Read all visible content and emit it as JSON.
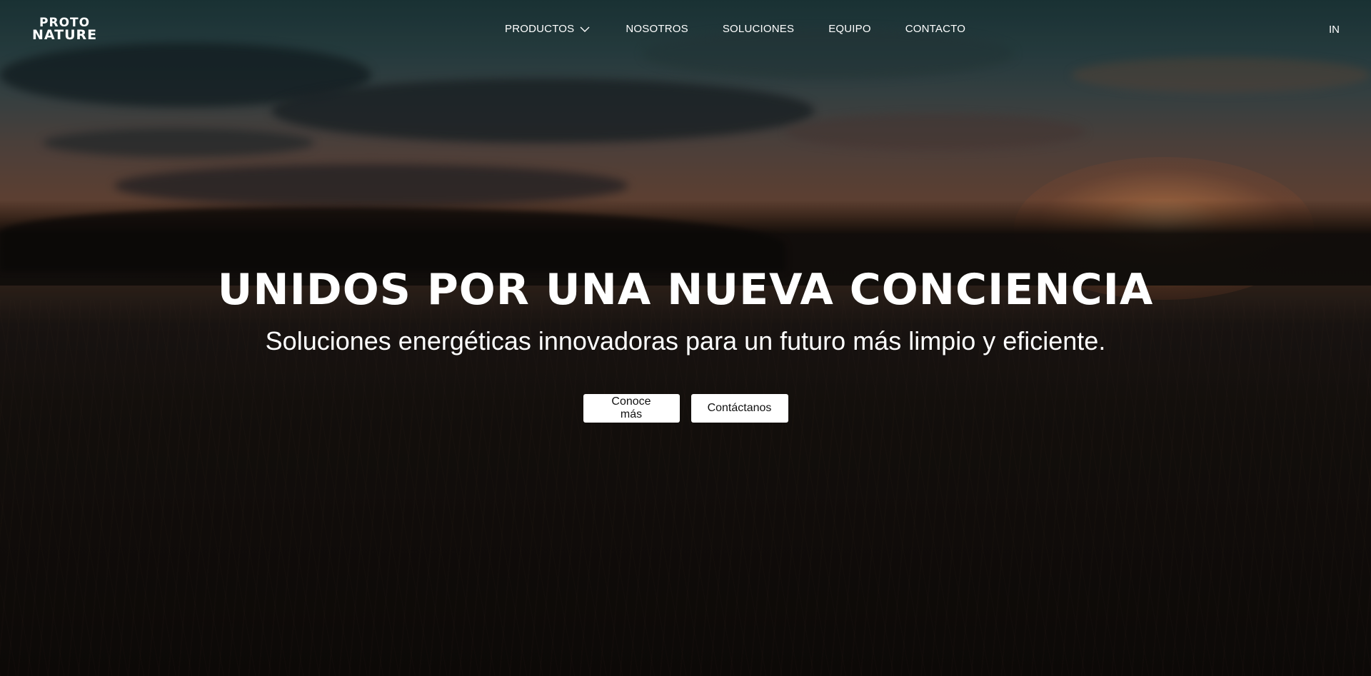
{
  "nav": {
    "logo": {
      "line1": "PROTO",
      "line2": "NATURE"
    },
    "items": [
      {
        "label": "PRODUCTOS",
        "has_dropdown": true,
        "icon": "chevron-down-icon"
      },
      {
        "label": "NOSOTROS"
      },
      {
        "label": "SOLUCIONES"
      },
      {
        "label": "EQUIPO"
      },
      {
        "label": "CONTACTO"
      }
    ],
    "language": "IN"
  },
  "hero": {
    "headline": "UNIDOS POR UNA NUEVA CONCIENCIA",
    "subheadline": "Soluciones energéticas innovadoras para un futuro más limpio y eficiente.",
    "buttons": {
      "primary": "Conoce más",
      "secondary": "Contáctanos"
    }
  },
  "colors": {
    "text": "#ffffff",
    "button_bg": "#ffffff",
    "button_text": "#111111"
  }
}
